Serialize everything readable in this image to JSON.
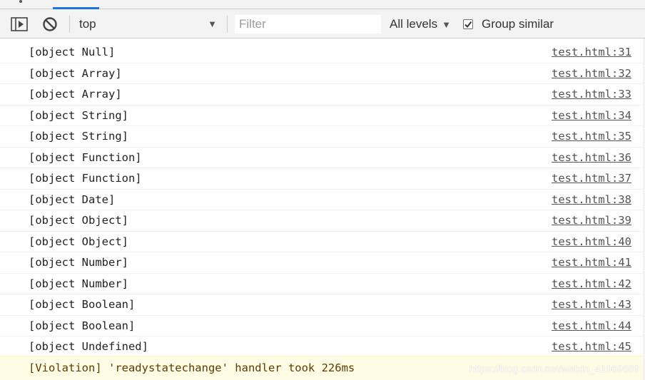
{
  "toolbar": {
    "sidebar_icon": "sidebar-toggle-icon",
    "clear_icon": "clear-console-icon",
    "context": "top",
    "filter_placeholder": "Filter",
    "levels": "All levels",
    "group_similar_label": "Group similar",
    "group_similar_checked": true
  },
  "logs": [
    {
      "message": "[object Null]",
      "source": "test.html:31"
    },
    {
      "message": "[object Array]",
      "source": "test.html:32"
    },
    {
      "message": "[object Array]",
      "source": "test.html:33"
    },
    {
      "message": "[object String]",
      "source": "test.html:34"
    },
    {
      "message": "[object String]",
      "source": "test.html:35"
    },
    {
      "message": "[object Function]",
      "source": "test.html:36"
    },
    {
      "message": "[object Function]",
      "source": "test.html:37"
    },
    {
      "message": "[object Date]",
      "source": "test.html:38"
    },
    {
      "message": "[object Object]",
      "source": "test.html:39"
    },
    {
      "message": "[object Object]",
      "source": "test.html:40"
    },
    {
      "message": "[object Number]",
      "source": "test.html:41"
    },
    {
      "message": "[object Number]",
      "source": "test.html:42"
    },
    {
      "message": "[object Boolean]",
      "source": "test.html:43"
    },
    {
      "message": "[object Boolean]",
      "source": "test.html:44"
    },
    {
      "message": "[object Undefined]",
      "source": "test.html:45"
    }
  ],
  "violation": {
    "message": "[Violation] 'readystatechange' handler took 226ms"
  },
  "watermark": "https://blog.csdn.net/weixin_41969689",
  "colors": {
    "toolbar_bg": "#f3f3f3",
    "tab_accent": "#1a73e8",
    "violation_bg": "#fffbe5",
    "violation_text": "#5c3c00"
  }
}
